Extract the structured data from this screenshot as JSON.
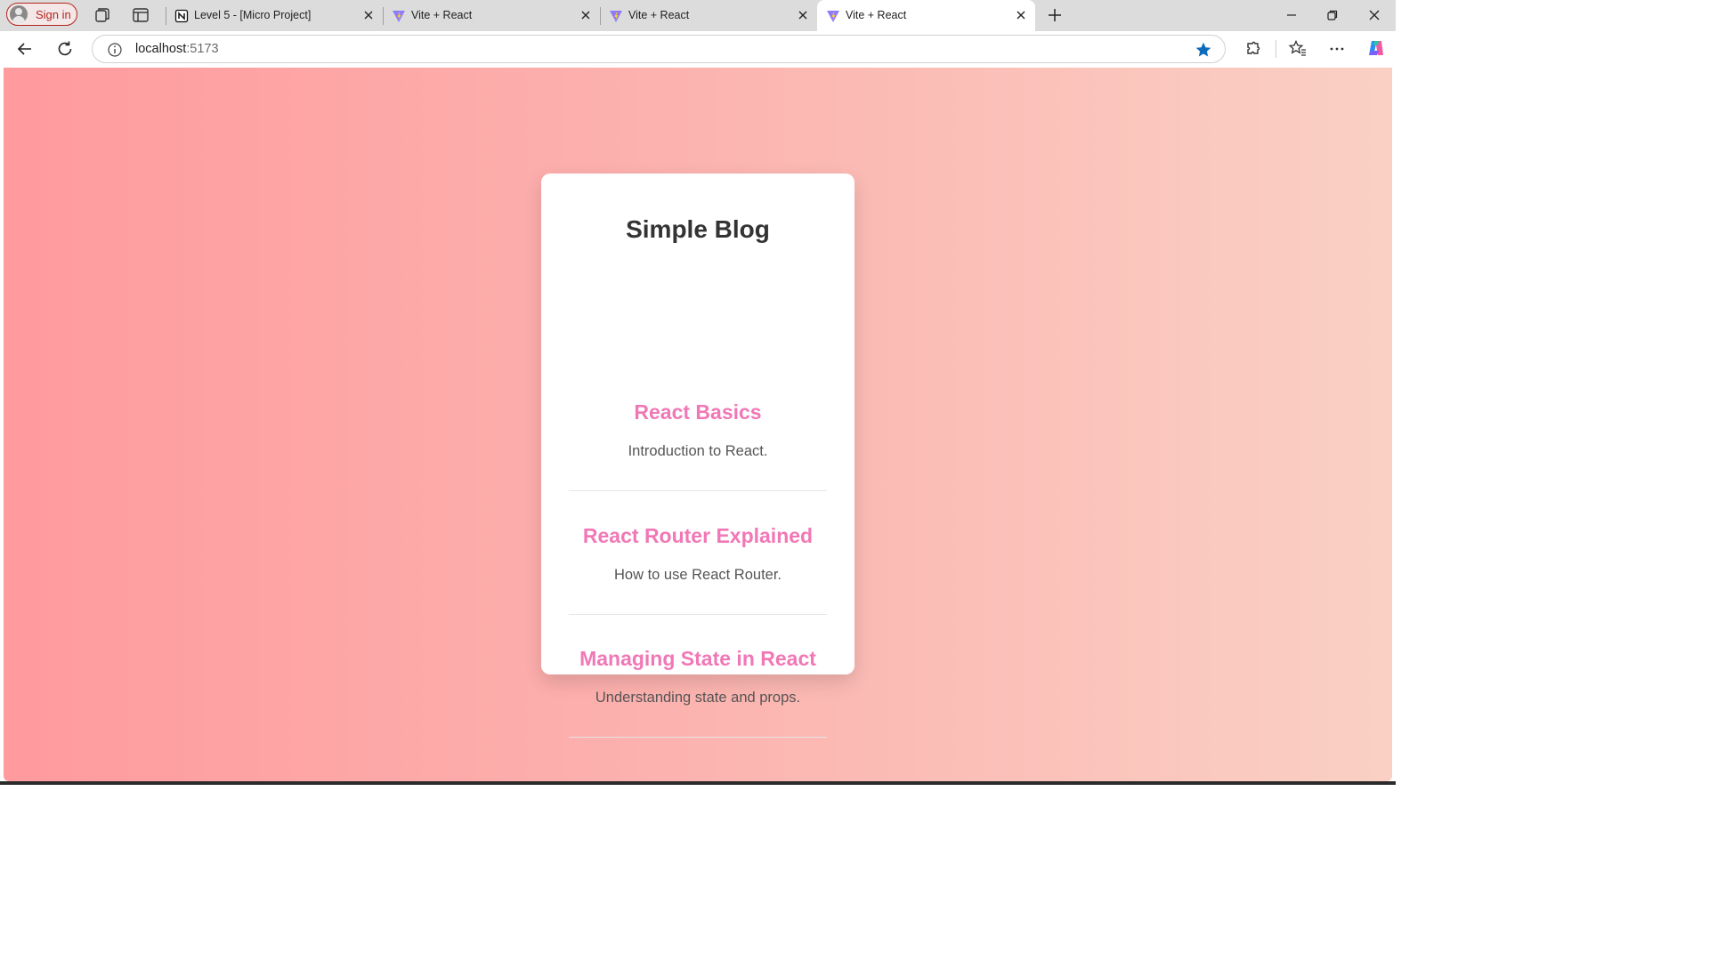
{
  "browser": {
    "sign_in_label": "Sign in",
    "tabs": [
      {
        "title": "Level 5 - [Micro Project]",
        "favicon": "notion-icon",
        "active": false
      },
      {
        "title": "Vite + React",
        "favicon": "vite-icon",
        "active": false
      },
      {
        "title": "Vite + React",
        "favicon": "vite-icon",
        "active": false
      },
      {
        "title": "Vite + React",
        "favicon": "vite-icon",
        "active": true
      }
    ],
    "address": {
      "host": "localhost",
      "port": ":5173"
    },
    "accent_color": "#0f6cbd"
  },
  "page": {
    "title": "Simple Blog",
    "posts": [
      {
        "title": "React Basics",
        "summary": "Introduction to React."
      },
      {
        "title": "React Router Explained",
        "summary": "How to use React Router."
      },
      {
        "title": "Managing State in React",
        "summary": "Understanding state and props."
      }
    ],
    "colors": {
      "gradient_start": "#ff9a9e",
      "gradient_end": "#fad0c4",
      "post_title": "#f178b6",
      "heading": "#333333"
    }
  }
}
